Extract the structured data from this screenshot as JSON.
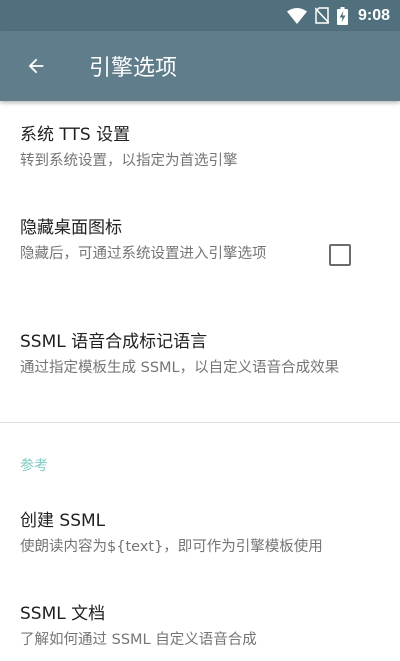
{
  "status_bar": {
    "time": "9:08",
    "icons": [
      "wifi-icon",
      "no-sim-icon",
      "battery-charging-icon"
    ]
  },
  "app_bar": {
    "title": "引擎选项",
    "back_icon": "arrow-back-icon"
  },
  "preferences": [
    {
      "title": "系统 TTS 设置",
      "summary": "转到系统设置，以指定为首选引擎"
    },
    {
      "title": "隐藏桌面图标",
      "summary": "隐藏后，可通过系统设置进入引擎选项",
      "checkbox": false
    },
    {
      "title": "SSML 语音合成标记语言",
      "summary": "通过指定模板生成 SSML，以自定义语音合成效果"
    }
  ],
  "reference_section": {
    "header": "参考",
    "items": [
      {
        "title": "创建 SSML",
        "summary": "使朗读内容为${text}，即可作为引擎模板使用"
      },
      {
        "title": "SSML 文档",
        "summary": "了解如何通过 SSML 自定义语音合成"
      }
    ]
  },
  "colors": {
    "status_bar": "#51707d",
    "app_bar": "#607d8b",
    "category_accent": "#80cbc4"
  }
}
